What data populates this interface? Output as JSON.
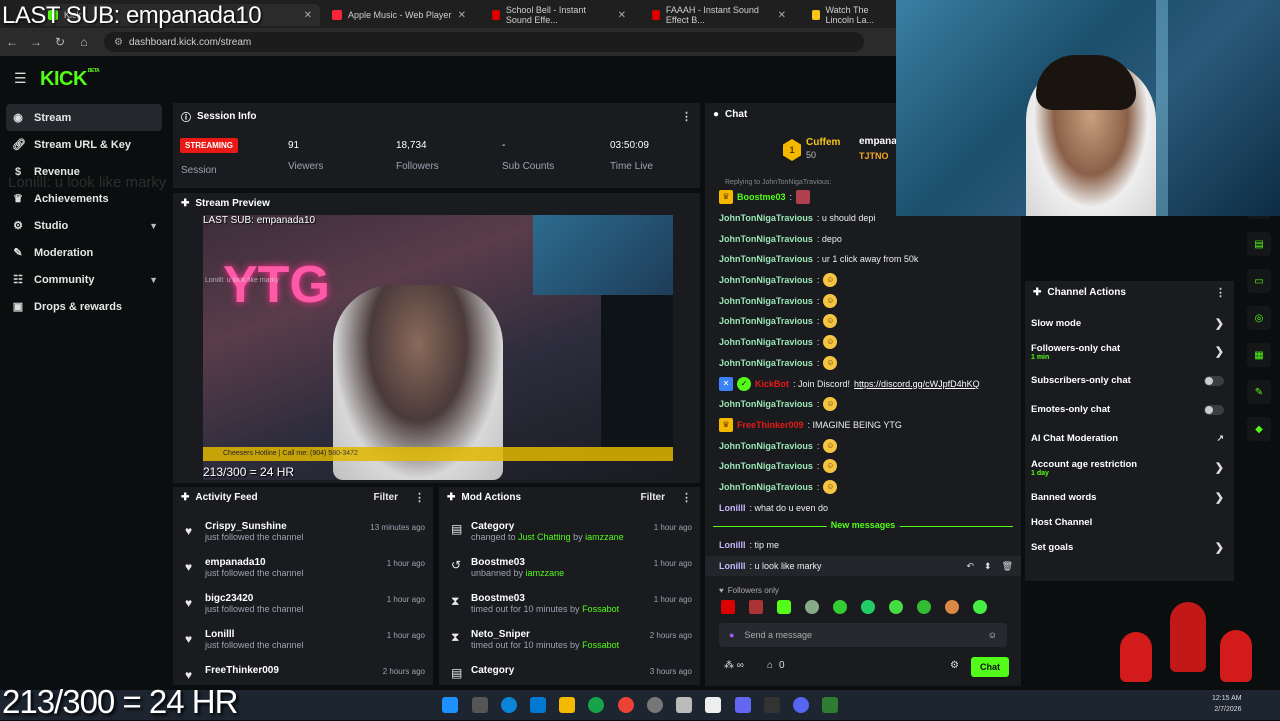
{
  "browser": {
    "tabs": [
      {
        "label": "Kick",
        "color": "#53fc18"
      },
      {
        "label": "Apple Music - Web Player",
        "color": "#fa243c"
      },
      {
        "label": "School Bell - Instant Sound Effe...",
        "color": "#d00"
      },
      {
        "label": "FAAAH - Instant Sound Effect B...",
        "color": "#d00"
      },
      {
        "label": "Watch The Lincoln La...",
        "color": "#f5c518"
      }
    ],
    "url": "dashboard.kick.com/stream"
  },
  "overlay": {
    "last_sub": "LAST SUB: empanada10",
    "ghost_chat": "Lonilll: u look like marky",
    "goal": "213/300 = 24 HR"
  },
  "header": {
    "logo": "KICK",
    "logo_tag": "BETA"
  },
  "sidebar": {
    "items": [
      {
        "label": "Stream",
        "icon": "play-circle-icon"
      },
      {
        "label": "Stream URL & Key",
        "icon": "link-icon"
      },
      {
        "label": "Revenue",
        "icon": "dollar-icon"
      },
      {
        "label": "Achievements",
        "icon": "trophy-icon"
      },
      {
        "label": "Studio",
        "icon": "gear-icon"
      },
      {
        "label": "Moderation",
        "icon": "wrench-icon"
      },
      {
        "label": "Community",
        "icon": "group-icon"
      },
      {
        "label": "Drops & rewards",
        "icon": "gift-icon"
      }
    ]
  },
  "session": {
    "title": "Session Info",
    "badge": "STREAMING",
    "session_label": "Session",
    "stats": [
      {
        "value": "91",
        "label": "Viewers"
      },
      {
        "value": "18,734",
        "label": "Followers"
      },
      {
        "value": "-",
        "label": "Sub Counts"
      },
      {
        "value": "03:50:09",
        "label": "Time Live"
      }
    ]
  },
  "preview": {
    "title": "Stream Preview",
    "last_sub": "LAST SUB: empanada10",
    "neon": "YTG",
    "ghost_chat": "Lonilll: u look like marky",
    "goal": "213/300 = 24 HR",
    "ticker": "Cheesers Hotline | Call me: (904) 580-3472"
  },
  "activity": {
    "title": "Activity Feed",
    "filter": "Filter",
    "rows": [
      {
        "name": "Crispy_Sunshine",
        "sub": "just followed the channel",
        "time": "13 minutes ago"
      },
      {
        "name": "empanada10",
        "sub": "just followed the channel",
        "time": "1 hour ago"
      },
      {
        "name": "bigc23420",
        "sub": "just followed the channel",
        "time": "1 hour ago"
      },
      {
        "name": "Lonilll",
        "sub": "just followed the channel",
        "time": "1 hour ago"
      },
      {
        "name": "FreeThinker009",
        "sub": "",
        "time": "2 hours ago"
      }
    ]
  },
  "mod": {
    "title": "Mod Actions",
    "filter": "Filter",
    "rows": [
      {
        "name": "Category",
        "pre": "changed to ",
        "hl": "Just Chatting",
        "mid": " by ",
        "by": "iamzzane",
        "time": "1 hour ago",
        "icon": "category-icon"
      },
      {
        "name": "Boostme03",
        "pre": "unbanned by ",
        "hl": "",
        "mid": "",
        "by": "iamzzane",
        "time": "1 hour ago",
        "icon": "undo-icon"
      },
      {
        "name": "Boostme03",
        "pre": "timed out for 10 minutes by ",
        "hl": "",
        "mid": "",
        "by": "Fossabot",
        "time": "1 hour ago",
        "icon": "hourglass-icon"
      },
      {
        "name": "Neto_Sniper",
        "pre": "timed out for 10 minutes by ",
        "hl": "",
        "mid": "",
        "by": "Fossabot",
        "time": "2 hours ago",
        "icon": "hourglass-icon"
      },
      {
        "name": "Category",
        "pre": "",
        "hl": "",
        "mid": "",
        "by": "",
        "time": "3 hours ago",
        "icon": "category-icon"
      }
    ]
  },
  "chat": {
    "title": "Chat",
    "pinned_user": "Cuffem",
    "pinned_count": "50",
    "pinned_user2": "empana",
    "pinned_tag": "TJTNO",
    "replying": "Replying to JohnTonNigaTravious:",
    "lines": [
      {
        "user": "Boostme03",
        "text": ":",
        "color": "#53fc18",
        "emoji": true
      },
      {
        "user": "JohnTonNigaTravious",
        "text": ": u should depi",
        "color": "#9ae6b4",
        "emoji": false
      },
      {
        "user": "JohnTonNigaTravious",
        "text": ": depo",
        "color": "#9ae6b4",
        "emoji": false
      },
      {
        "user": "JohnTonNigaTravious",
        "text": ": ur 1 click away from 50k",
        "color": "#9ae6b4",
        "emoji": false
      },
      {
        "user": "JohnTonNigaTravious",
        "text": ":",
        "color": "#9ae6b4",
        "emoji": true
      },
      {
        "user": "JohnTonNigaTravious",
        "text": ":",
        "color": "#9ae6b4",
        "emoji": true
      },
      {
        "user": "JohnTonNigaTravious",
        "text": ":",
        "color": "#9ae6b4",
        "emoji": true
      },
      {
        "user": "JohnTonNigaTravious",
        "text": ":",
        "color": "#9ae6b4",
        "emoji": true
      },
      {
        "user": "JohnTonNigaTravious",
        "text": ":",
        "color": "#9ae6b4",
        "emoji": true
      },
      {
        "user": "KickBot",
        "text": ": Join Discord! ",
        "color": "#e91916",
        "emoji": false,
        "link": "https://discord.gg/cWJpfD4hKQ"
      },
      {
        "user": "JohnTonNigaTravious",
        "text": ":",
        "color": "#9ae6b4",
        "emoji": true
      },
      {
        "user": "FreeThinker009",
        "text": ": IMAGINE BEING YTG",
        "color": "#e91916",
        "emoji": false
      },
      {
        "user": "JohnTonNigaTravious",
        "text": ":",
        "color": "#9ae6b4",
        "emoji": true
      },
      {
        "user": "JohnTonNigaTravious",
        "text": ":",
        "color": "#9ae6b4",
        "emoji": true
      },
      {
        "user": "JohnTonNigaTravious",
        "text": ":",
        "color": "#9ae6b4",
        "emoji": true
      },
      {
        "user": "Lonilll",
        "text": ": what do u even do",
        "color": "#c4b5fd",
        "emoji": false
      }
    ],
    "new_messages": "New messages",
    "new_lines": [
      {
        "user": "Lonilll",
        "text": ": tip me",
        "color": "#c4b5fd"
      },
      {
        "user": "Lonilll",
        "text": ": u look like marky",
        "color": "#c4b5fd"
      }
    ],
    "followers_only": "Followers only",
    "placeholder": "Send a message",
    "count": "0",
    "send": "Chat"
  },
  "channel_actions": {
    "title": "Channel Actions",
    "rows": [
      {
        "label": "Slow mode",
        "sub": "",
        "control": "arrow"
      },
      {
        "label": "Followers-only chat",
        "sub": "1 min",
        "control": "arrow"
      },
      {
        "label": "Subscribers-only chat",
        "sub": "",
        "control": "toggle"
      },
      {
        "label": "Emotes-only chat",
        "sub": "",
        "control": "toggle"
      },
      {
        "label": "AI Chat Moderation",
        "sub": "",
        "control": "external"
      },
      {
        "label": "Account age restriction",
        "sub": "1 day",
        "control": "arrow"
      },
      {
        "label": "Banned words",
        "sub": "",
        "control": "arrow"
      },
      {
        "label": "Host Channel",
        "sub": "",
        "control": "none"
      },
      {
        "label": "Set goals",
        "sub": "",
        "control": "arrow"
      }
    ]
  },
  "taskbar": {
    "time": "12:15 AM",
    "date": "2/7/2026"
  },
  "colors": {
    "accent": "#53fc18",
    "live": "#e91916",
    "panel": "#191b1f",
    "bg": "#0b0e0f"
  }
}
